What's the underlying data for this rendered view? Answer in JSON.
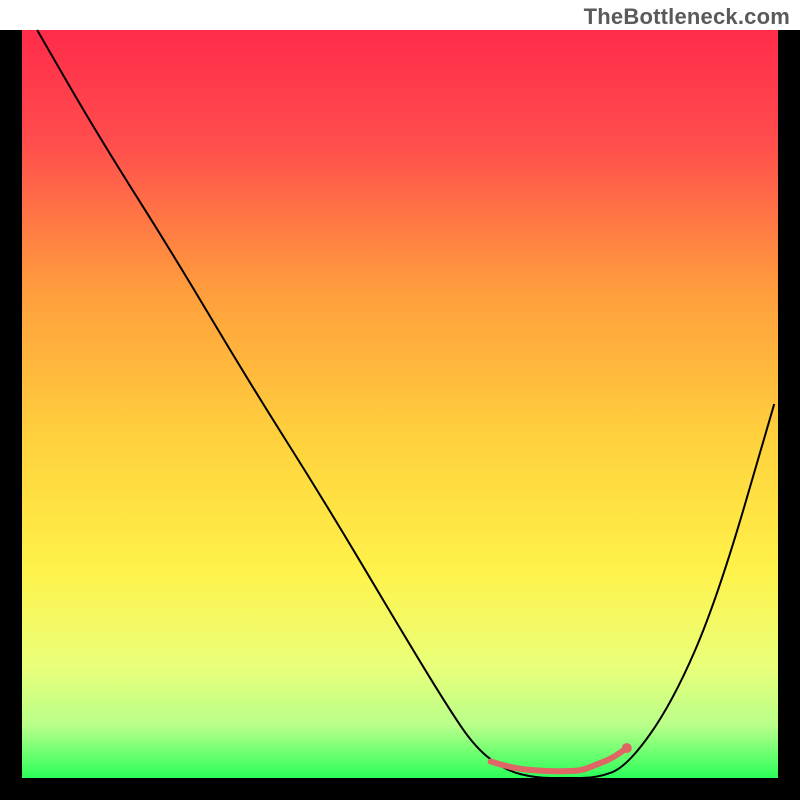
{
  "watermark": "TheBottleneck.com",
  "chart_data": {
    "type": "line",
    "title": "",
    "xlabel": "",
    "ylabel": "",
    "xlim": [
      0,
      100
    ],
    "ylim": [
      0,
      100
    ],
    "grid": false,
    "legend": false,
    "background_gradient": {
      "stops": [
        {
          "offset": 0.0,
          "color": "#ff2b4a"
        },
        {
          "offset": 0.15,
          "color": "#ff4d4d"
        },
        {
          "offset": 0.35,
          "color": "#ff9e3d"
        },
        {
          "offset": 0.55,
          "color": "#ffd23d"
        },
        {
          "offset": 0.72,
          "color": "#fff24a"
        },
        {
          "offset": 0.85,
          "color": "#eaff7a"
        },
        {
          "offset": 0.93,
          "color": "#b8ff8a"
        },
        {
          "offset": 1.0,
          "color": "#2bff5a"
        }
      ]
    },
    "series": [
      {
        "name": "bottleneck-curve",
        "color": "#000000",
        "width": 2,
        "x": [
          2,
          10,
          20,
          30,
          40,
          50,
          56,
          60,
          64,
          68,
          72,
          76,
          80,
          86,
          92,
          99.5
        ],
        "y": [
          100,
          86,
          70,
          53,
          37,
          20,
          10,
          4,
          1,
          0,
          0,
          0,
          1.5,
          10,
          24,
          50
        ]
      },
      {
        "name": "optimal-range-marker",
        "color": "#e06666",
        "width": 6,
        "x": [
          62,
          64,
          66,
          68,
          70,
          72,
          74,
          76,
          78,
          80
        ],
        "y": [
          2.2,
          1.6,
          1.2,
          1.0,
          0.9,
          0.9,
          1.0,
          1.8,
          2.6,
          4.0
        ],
        "end_dot": {
          "x": 80,
          "y": 4.0,
          "r": 5
        }
      }
    ],
    "axis_border_color": "#000000",
    "axis_border_width_left_right_bottom": 22,
    "axis_border_width_top": 0
  }
}
